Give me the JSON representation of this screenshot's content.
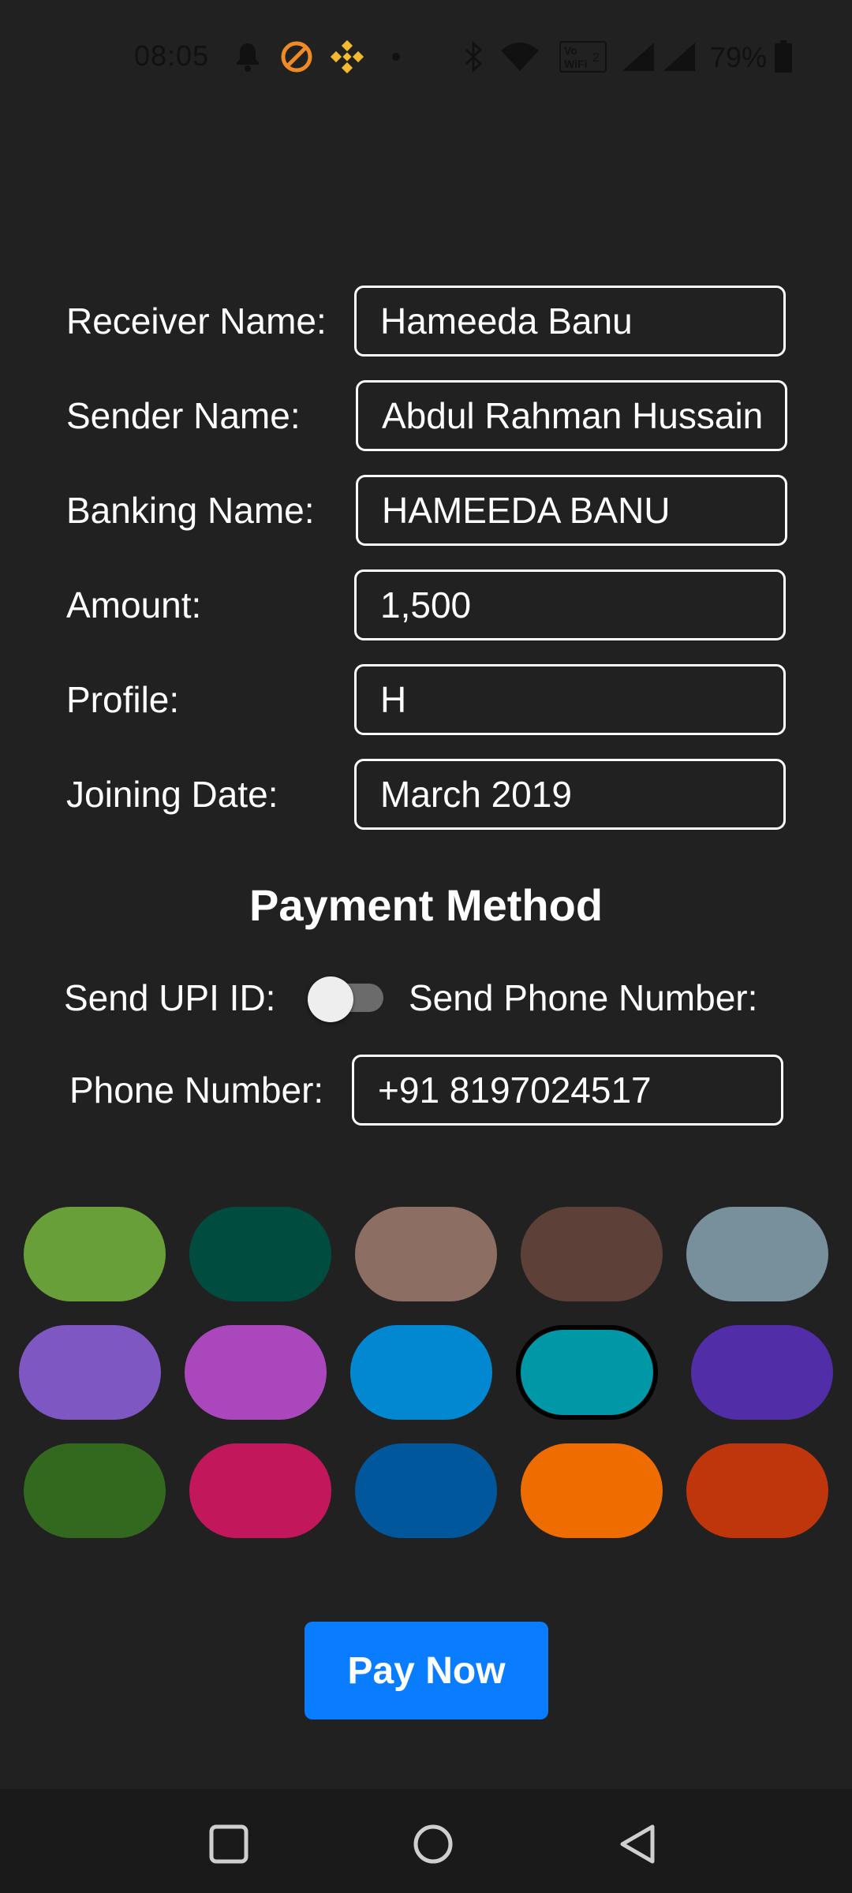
{
  "status_bar": {
    "time": "08:05",
    "battery_percent": "79%",
    "icons": [
      "bell-icon",
      "do-not-disturb-icon",
      "binance-icon",
      "dot-icon",
      "bluetooth-icon",
      "wifi-icon",
      "vowifi-icon",
      "signal-icon",
      "signal-r-icon",
      "battery-icon"
    ],
    "colors": {
      "dnd": "#f08a24",
      "binance": "#f3ba2f",
      "icons": "#111111"
    }
  },
  "form": {
    "receiver_name": {
      "label": "Receiver Name:",
      "value": "Hameeda Banu"
    },
    "sender_name": {
      "label": "Sender Name:",
      "value": "Abdul Rahman Hussain"
    },
    "banking_name": {
      "label": "Banking Name:",
      "value": "HAMEEDA BANU"
    },
    "amount": {
      "label": "Amount:",
      "value": "1,500"
    },
    "profile": {
      "label": "Profile:",
      "value": "H"
    },
    "joining_date": {
      "label": "Joining Date:",
      "value": "March 2019"
    }
  },
  "payment_method": {
    "title": "Payment Method",
    "upi_label": "Send UPI ID:",
    "phone_toggle_label": "Send Phone Number:",
    "toggle_on": false,
    "phone_label": "Phone Number:",
    "phone_value": "+91 8197024517"
  },
  "colors": {
    "selected_index": 8,
    "palette": [
      "#689f38",
      "#004d40",
      "#8d6e63",
      "#5d4037",
      "#78909c",
      "#7e57c2",
      "#ab47bc",
      "#0288d1",
      "#0097a7",
      "#512da8",
      "#33691e",
      "#c2185b",
      "#01579b",
      "#ef6c00",
      "#bf360c"
    ]
  },
  "pay_button": {
    "label": "Pay Now",
    "color": "#0a7cff"
  },
  "nav_bar": {
    "icons": [
      "recent-apps-icon",
      "home-icon",
      "back-icon"
    ]
  }
}
